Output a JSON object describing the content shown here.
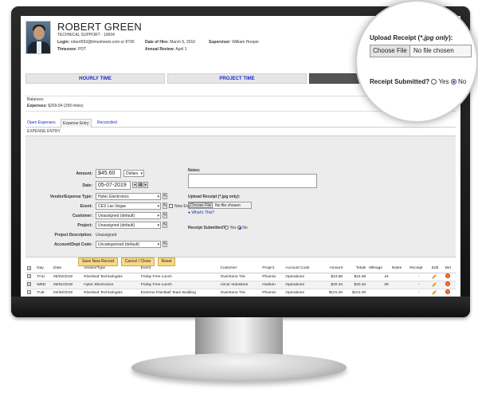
{
  "employee": {
    "name": "ROBERT GREEN",
    "role": "TECHNICAL SUPPORT  ·  10004",
    "login_label": "Login:",
    "login_value": "robert593@timesheets.com  or  8790",
    "timezone_label": "Timezone:",
    "timezone_value": "PDT",
    "hire_label": "Date of Hire:",
    "hire_value": "March 5, 2010",
    "review_label": "Annual Review:",
    "review_value": "April 1",
    "supervisor_label": "Supervisor:",
    "supervisor_value": "William Hooper"
  },
  "nav_tabs": [
    {
      "label": "HOURLY TIME"
    },
    {
      "label": "PROJECT TIME"
    },
    {
      "label": "E"
    }
  ],
  "balances": {
    "title": "Balances",
    "expenses_label": "Expenses:",
    "expenses_value": "$269.94 (299 miles)"
  },
  "sub_tabs": [
    {
      "label": "Open Expenses"
    },
    {
      "label": "Expense Entry"
    },
    {
      "label": "Reconciled"
    }
  ],
  "entry": {
    "header": "EXPENSE ENTRY",
    "amount_label": "Amount:",
    "amount_value": "$45.60",
    "currency_value": "Dollars",
    "date_label": "Date:",
    "date_value": "05-07-2019",
    "vendor_label": "Vendor/Expense Type:",
    "vendor_value": "Hytec Electronics",
    "event_label": "Event:",
    "event_value": "CES Las Vegas",
    "new_event_label": "New Event",
    "customer_label": "Customer:",
    "customer_value": "Unassigned (default)",
    "project_label": "Project:",
    "project_value": "Unassigned (default)",
    "project_desc_label": "Project Description:",
    "project_desc_value": "Unassigned",
    "account_label": "Account/Dept Code:",
    "account_value": "Uncategorized (default)",
    "notes_label": "Notes:",
    "notes_value": "",
    "upload_label": "Upload Receipt (*.jpg only):",
    "choose_file": "Choose File",
    "no_file": "No file chosen",
    "whats_this": "What's This?",
    "submitted_label": "Receipt Submitted?",
    "yes_label": "Yes",
    "no_label": "No",
    "save_button": "Save New Record",
    "cancel_button": "Cancel / Close",
    "reset_button": "Reset"
  },
  "table": {
    "columns": [
      "Day",
      "Date",
      "Vendor/Type",
      "Event",
      "Customer",
      "Project",
      "Account Code",
      "Amount",
      "Totals",
      "Mileage",
      "Notes",
      "Receipt",
      "Edit",
      "Del"
    ],
    "rows": [
      {
        "day": "THU",
        "date": "05/02/2019",
        "vendor": "Riverbed Technologies",
        "event": "Friday Free Lunch",
        "customer": "Overstone Tire",
        "project": "Phoenix",
        "account": "Operations",
        "amount": "$24.86",
        "totals": "$24.86",
        "mileage": "44",
        "notes": "",
        "receipt": "-"
      },
      {
        "day": "WED",
        "date": "05/01/2019",
        "vendor": "Hytec Electronics",
        "event": "Friday Free Lunch",
        "customer": "Aircar Industries",
        "project": "Hudson",
        "account": "Operations",
        "amount": "$20.34",
        "totals": "$20.34",
        "mileage": "36",
        "notes": "",
        "receipt": "-"
      },
      {
        "day": "TUE",
        "date": "04/30/2019",
        "vendor": "Riverbed Technologies",
        "event": "Extreme Paintball Team Building",
        "customer": "Overstone Tire",
        "project": "Phoenix",
        "account": "Operations",
        "amount": "$101.00",
        "totals": "$101.00",
        "mileage": "",
        "notes": "",
        "receipt": "-"
      }
    ]
  },
  "magnifier": {
    "upload_label": "Upload Receipt (",
    "upload_label_em": "*.jpg only",
    "upload_label_end": "):",
    "choose_file": "Choose File",
    "no_file": "No file chosen",
    "submitted_label": "Receipt Submitted?",
    "yes_label": "Yes",
    "no_label": "No"
  },
  "colors": {
    "link_blue": "#1a2bd0",
    "button_yellow": "#f7d985",
    "active_tab": "#555555"
  }
}
